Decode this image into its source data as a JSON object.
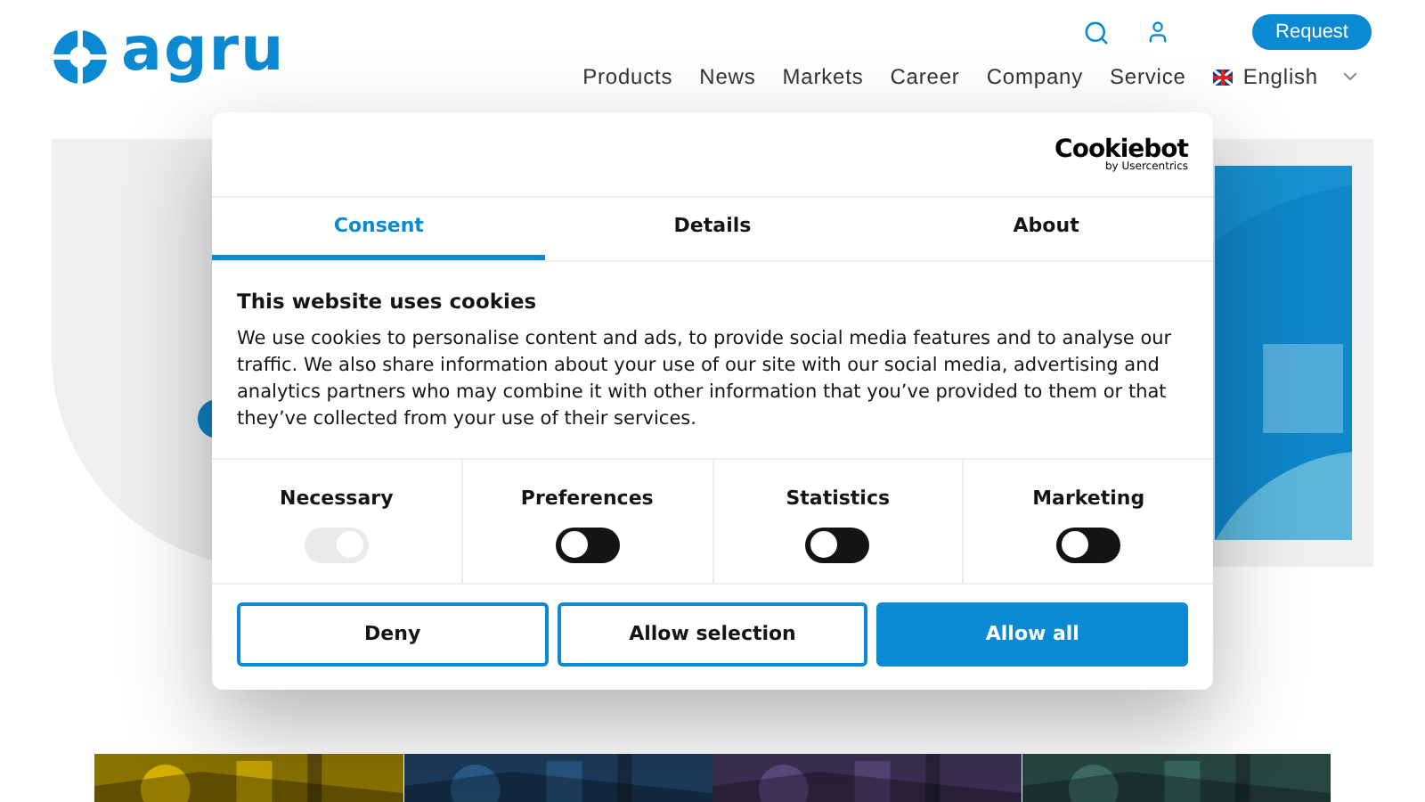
{
  "header": {
    "logo": "agru",
    "request_button": "Request",
    "nav": [
      {
        "label": "Products"
      },
      {
        "label": "News"
      },
      {
        "label": "Markets"
      },
      {
        "label": "Career"
      },
      {
        "label": "Company"
      },
      {
        "label": "Service"
      }
    ],
    "language": "English"
  },
  "cookie_dialog": {
    "brand": "Cookiebot",
    "brand_sub": "by Usercentrics",
    "tabs": [
      {
        "label": "Consent",
        "selected": true
      },
      {
        "label": "Details",
        "selected": false
      },
      {
        "label": "About",
        "selected": false
      }
    ],
    "title": "This website uses cookies",
    "text": "We use cookies to personalise content and ads, to provide social media features and to analyse our traffic. We also share information about your use of our site with our social media, advertising and analytics partners who may combine it with other information that you’ve provided to them or that they’ve collected from your use of their services.",
    "categories": [
      {
        "label": "Necessary",
        "on": true,
        "disabled": true
      },
      {
        "label": "Preferences",
        "on": false,
        "disabled": false
      },
      {
        "label": "Statistics",
        "on": false,
        "disabled": false
      },
      {
        "label": "Marketing",
        "on": false,
        "disabled": false
      }
    ],
    "buttons": [
      {
        "label": "Deny",
        "kind": "outline"
      },
      {
        "label": "Allow selection",
        "kind": "outline"
      },
      {
        "label": "Allow all",
        "kind": "primary"
      }
    ]
  }
}
